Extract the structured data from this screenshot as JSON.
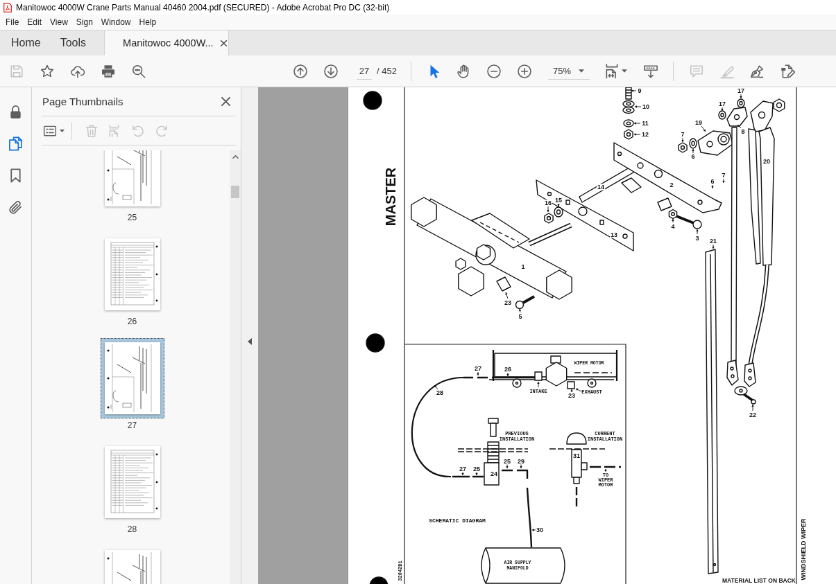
{
  "window": {
    "title": "Manitowoc 4000W Crane Parts Manual 40460 2004.pdf (SECURED) - Adobe Acrobat Pro DC (32-bit)"
  },
  "menu": [
    "File",
    "Edit",
    "View",
    "Sign",
    "Window",
    "Help"
  ],
  "tabs": [
    {
      "label": "Home",
      "selected": false,
      "closable": false
    },
    {
      "label": "Tools",
      "selected": false,
      "closable": false
    },
    {
      "label": "Manitowoc 4000W...",
      "selected": true,
      "closable": true
    }
  ],
  "toolbar": {
    "file_buttons": [
      {
        "kind": "save",
        "disabled": true
      },
      {
        "kind": "favorite",
        "disabled": false
      },
      {
        "kind": "upload",
        "disabled": false
      },
      {
        "kind": "print",
        "disabled": false
      },
      {
        "kind": "find",
        "disabled": false
      }
    ],
    "page_number": "27",
    "page_count": "/ 452",
    "tools": [
      {
        "kind": "select",
        "selected": true
      },
      {
        "kind": "hand",
        "selected": false
      }
    ],
    "zoom": "75%",
    "annotate_buttons": [
      {
        "kind": "comment",
        "disabled": true
      },
      {
        "kind": "highlight",
        "disabled": true
      },
      {
        "kind": "sign",
        "disabled": false
      },
      {
        "kind": "edit",
        "disabled": false
      }
    ]
  },
  "left_rail": [
    {
      "kind": "lock",
      "selected": false
    },
    {
      "kind": "pages",
      "selected": true
    },
    {
      "kind": "bookmarks",
      "selected": false
    },
    {
      "kind": "attachments",
      "selected": false
    }
  ],
  "thumbnails_panel": {
    "title": "Page Thumbnails",
    "tools": [
      {
        "kind": "options",
        "disabled": false
      },
      {
        "kind": "delete",
        "disabled": true
      },
      {
        "kind": "extract",
        "disabled": true
      },
      {
        "kind": "undo",
        "disabled": true
      },
      {
        "kind": "redo",
        "disabled": true
      }
    ],
    "thumbnails": [
      {
        "label": "25",
        "kind": "drawing",
        "selected": false
      },
      {
        "label": "26",
        "kind": "table",
        "selected": false
      },
      {
        "label": "27",
        "kind": "drawing",
        "selected": true
      },
      {
        "label": "28",
        "kind": "table",
        "selected": false
      },
      {
        "kind": "drawing",
        "selected": false
      }
    ]
  },
  "document": {
    "side_title": "MASTER",
    "callouts": [
      "9",
      "10",
      "11",
      "12",
      "14",
      "2",
      "16",
      "15",
      "13",
      "1",
      "23",
      "5",
      "4",
      "3",
      "19",
      "7",
      "6",
      "17",
      "17",
      "8",
      "20",
      "6",
      "7",
      "21",
      "22"
    ],
    "schematic": {
      "title": "SCHEMATIC DIAGRAM",
      "labels": [
        "27",
        "26",
        "WIPER MOTOR",
        "28",
        "INTAKE",
        "23",
        "EXHAUST",
        "PREVIOUS INSTALLATION",
        "CURRENT INSTALLATION",
        "31",
        "27",
        "25",
        "24",
        "25",
        "29",
        "TO WIPER MOTOR",
        "30",
        "AIR SUPPLY MANIFOLD"
      ]
    },
    "drawing_number": "32842D1",
    "sheet_title": "WINDSHIELD WIPER",
    "footer_note": "MATERIAL LIST ON BACK"
  }
}
